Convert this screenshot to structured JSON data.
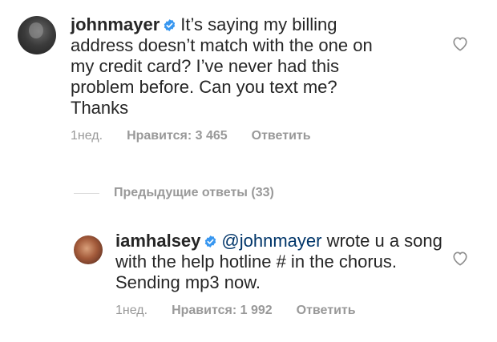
{
  "main_comment": {
    "username": "johnmayer",
    "text": "It’s saying my billing address doesn’t match with the one on my credit card? I’ve never had this problem before. Can you text me? Thanks",
    "time": "1нед.",
    "likes": "Нравится: 3 465",
    "reply_label": "Ответить"
  },
  "view_replies": {
    "label": "Предыдущие ответы (33)"
  },
  "reply_comment": {
    "username": "iamhalsey",
    "mention": "@johnmayer",
    "text": " wrote u a song with the help hotline # in the chorus. Sending mp3 now.",
    "time": "1нед.",
    "likes": "Нравится: 1 992",
    "reply_label": "Ответить"
  },
  "colors": {
    "text": "#262626",
    "meta": "#999999",
    "verified": "#3897f0",
    "mention": "#003569"
  },
  "icons": {
    "verified": "verified-badge-icon",
    "like": "heart-outline-icon"
  }
}
